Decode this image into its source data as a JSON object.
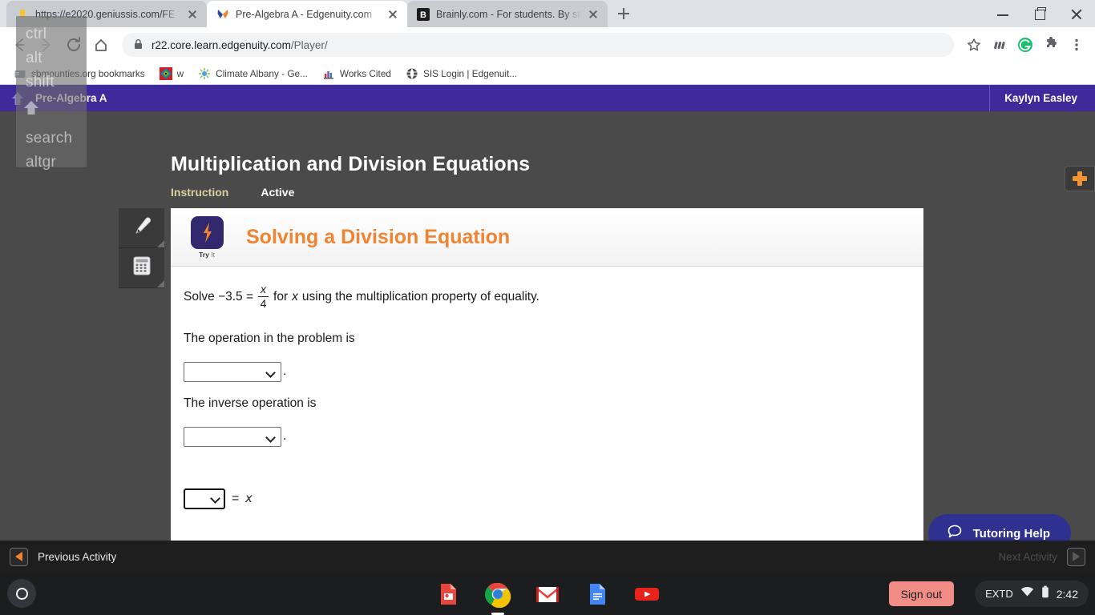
{
  "browser": {
    "tabs": [
      {
        "title": "https://e2020.geniussis.com/FE",
        "favicon": "bookmark-yellow-icon",
        "active": false
      },
      {
        "title": "Pre-Algebra A - Edgenuity.com",
        "favicon": "edgenuity-x-icon",
        "active": true
      },
      {
        "title": "Brainly.com - For students. By st",
        "favicon": "brainly-b-icon",
        "active": false
      }
    ],
    "newtab_label": "New Tab",
    "window_controls": {
      "minimize": "minimize",
      "maximize": "maximize",
      "close": "close"
    },
    "toolbar": {
      "back": "back-arrow",
      "forward": "forward-arrow",
      "reload": "reload-icon",
      "home": "home-icon",
      "lock": "lock-icon",
      "url_host": "r22.core.learn.edgenuity.com",
      "url_path": "/Player/",
      "star": "bookmark-star-icon",
      "ext1": "extension-bars-icon",
      "grammarly": "grammarly-icon",
      "extensions": "puzzle-piece-icon",
      "menu": "three-dot-menu-icon"
    },
    "bookmarks": [
      {
        "label": "sbmounties.org bookmarks",
        "icon": "folder-icon"
      },
      {
        "label": "w",
        "icon": "colorful-diamond-icon"
      },
      {
        "label": "Climate Albany - Ge...",
        "icon": "starburst-icon"
      },
      {
        "label": "Works Cited",
        "icon": "chart-icon"
      },
      {
        "label": "SIS Login | Edgenuit...",
        "icon": "globe-icon"
      }
    ]
  },
  "edgenuity": {
    "course_name": "Pre-Algebra A",
    "user_name": "Kaylyn Easley",
    "home_icon": "home-up-arrow-icon",
    "lesson_title": "Multiplication and Division Equations",
    "lesson_tabs": [
      {
        "label": "Instruction",
        "state": "selected"
      },
      {
        "label": "Active",
        "state": "normal"
      }
    ],
    "plus_button": "add-icon",
    "tools": [
      {
        "name": "highlighter-tool",
        "icon": "highlighter-icon"
      },
      {
        "name": "calculator-tool",
        "icon": "calculator-icon"
      }
    ],
    "card": {
      "badge_title": "Try",
      "badge_title_it": "It",
      "title": "Solving a Division Equation",
      "problem": {
        "prefix": "Solve −3.5 =",
        "fraction_num": "x",
        "fraction_den": "4",
        "mid": "for",
        "variable": "x",
        "suffix": "using the multiplication property of equality."
      },
      "q1_text": "The operation in the problem is",
      "q1_value": "",
      "q1_period": ".",
      "q2_text": "The inverse operation is",
      "q2_value": "",
      "q2_period": ".",
      "q3_value": "",
      "q3_equals": "=",
      "q3_variable": "x"
    },
    "tutoring_label": "Tutoring Help",
    "tutoring_icon": "chat-bubble-icon",
    "previous_activity": "Previous Activity",
    "next_activity": "Next Activity"
  },
  "shelf": {
    "launcher": "launcher-circle-icon",
    "apps": [
      {
        "name": "google-slides",
        "running": false
      },
      {
        "name": "google-chrome",
        "running": true
      },
      {
        "name": "gmail",
        "running": false
      },
      {
        "name": "google-docs",
        "running": false
      },
      {
        "name": "youtube",
        "running": false
      }
    ],
    "signout_label": "Sign out",
    "network_label": "EXTD",
    "wifi_icon": "wifi-icon",
    "battery_icon": "battery-icon",
    "time": "2:42"
  },
  "key_overlay": {
    "keys": [
      "ctrl",
      "alt",
      "shift",
      "search",
      "altgr"
    ],
    "shift_arrow_icon": "shift-up-arrow-icon"
  }
}
